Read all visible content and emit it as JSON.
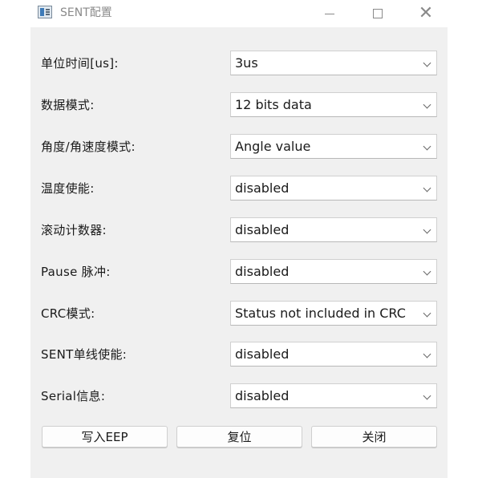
{
  "window": {
    "title": "SENT配置"
  },
  "form": {
    "rows": [
      {
        "label": "单位时间[us]:",
        "value": "3us"
      },
      {
        "label": "数据模式:",
        "value": "12 bits data"
      },
      {
        "label": "角度/角速度模式:",
        "value": "Angle value"
      },
      {
        "label": "温度使能:",
        "value": "disabled"
      },
      {
        "label": "滚动计数器:",
        "value": "disabled"
      },
      {
        "label": "Pause 脉冲:",
        "value": "disabled"
      },
      {
        "label": "CRC模式:",
        "value": "Status not included in CRC"
      },
      {
        "label": "SENT单线使能:",
        "value": "disabled"
      },
      {
        "label": "Serial信息:",
        "value": "disabled"
      }
    ]
  },
  "buttons": {
    "write": "写入EEP",
    "reset": "复位",
    "close": "关闭"
  }
}
